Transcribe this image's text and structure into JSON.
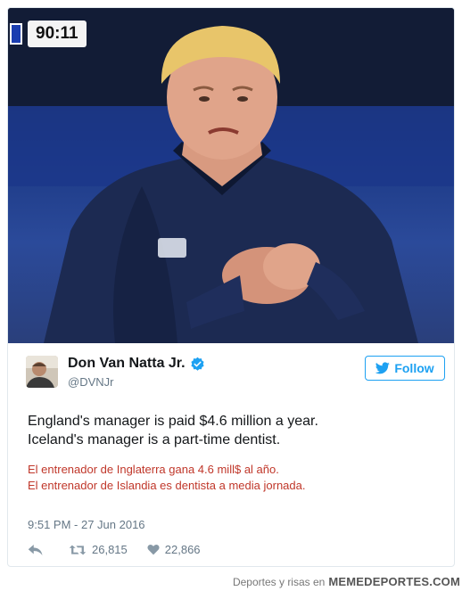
{
  "video": {
    "clock": "90:11",
    "team_color": "#1a3db0"
  },
  "tweet": {
    "author_name": "Don Van Natta Jr.",
    "handle": "@DVNJr",
    "follow_label": "Follow",
    "text_line1": "England's manager is paid $4.6 million a year.",
    "text_line2": "Iceland's manager is a part-time dentist.",
    "translation_line1": "El entrenador de Inglaterra gana 4.6 mill$ al año.",
    "translation_line2": "El entrenador de Islandia es dentista a media jornada.",
    "timestamp": "9:51 PM - 27 Jun 2016",
    "retweets": "26,815",
    "likes": "22,866",
    "icons": [
      "verified-icon",
      "twitter-bird-icon",
      "reply-icon",
      "retweet-icon",
      "heart-icon"
    ],
    "accent": "#1da1f2",
    "translation_color": "#c0372a"
  },
  "footer": {
    "prefix": "Deportes y risas en",
    "brand": "MEMEDEPORTES.COM"
  }
}
